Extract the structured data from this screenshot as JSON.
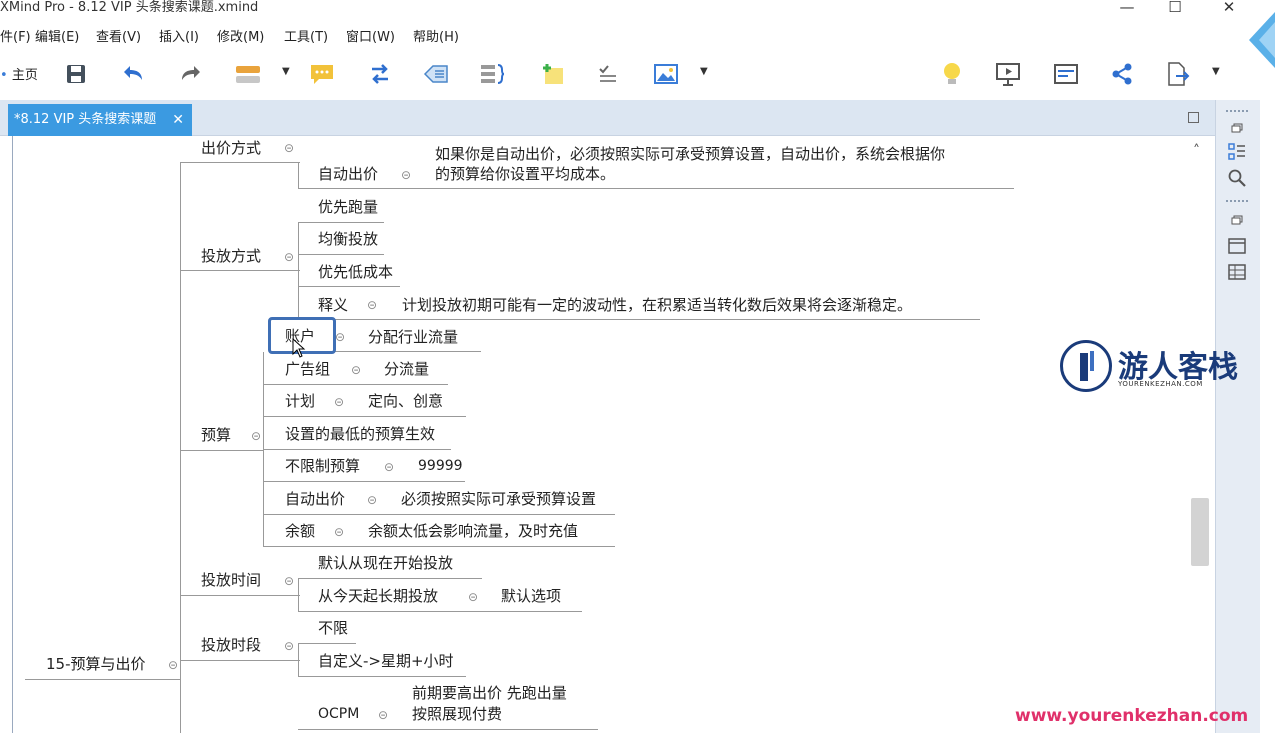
{
  "window": {
    "title": "XMind Pro - 8.12 VIP 头条搜索课题.xmind",
    "minimize": "—",
    "maximize": "☐",
    "close": "✕"
  },
  "menu": [
    "件(F)",
    "编辑(E)",
    "查看(V)",
    "插入(I)",
    "修改(M)",
    "工具(T)",
    "窗口(W)",
    "帮助(H)"
  ],
  "toolbar": {
    "home_label": "主页"
  },
  "tab": {
    "label": "*8.12 VIP 头条搜索课题",
    "close": "✕"
  },
  "canvas": {
    "scroll_up": "˄"
  },
  "mindmap": {
    "root": "15-预算与出价",
    "bid_method": {
      "label": "出价方式",
      "auto_bid": "自动出价",
      "auto_bid_note_1": "如果你是自动出价，必须按照实际可承受预算设置，自动出价，系统会根据你",
      "auto_bid_note_2": "的预算给你设置平均成本。"
    },
    "delivery_method": {
      "label": "投放方式",
      "items": [
        "优先跑量",
        "均衡投放",
        "优先低成本"
      ],
      "explain_label": "释义",
      "explain_text": "计划投放初期可能有一定的波动性，在积累适当转化数后效果将会逐渐稳定。"
    },
    "budget": {
      "label": "预算",
      "account": "账户",
      "account_note": "分配行业流量",
      "adgroup": "广告组",
      "adgroup_note": "分流量",
      "plan": "计划",
      "plan_note": "定向、创意",
      "min_budget": "设置的最低的预算生效",
      "unlimited": "不限制预算",
      "unlimited_note": "99999",
      "auto_bid": "自动出价",
      "auto_bid_note": "必须按照实际可承受预算设置",
      "balance": "余额",
      "balance_note": "余额太低会影响流量，及时充值"
    },
    "delivery_time": {
      "label": "投放时间",
      "item1": "默认从现在开始投放",
      "item2": "从今天起长期投放",
      "item2_note": "默认选项"
    },
    "delivery_period": {
      "label": "投放时段",
      "item1": "不限",
      "item2": "自定义->星期+小时"
    },
    "ocpm": {
      "label": "OCPM",
      "note_1": "前期要高出价 先跑出量",
      "note_2": "按照展现付费"
    }
  },
  "watermark": {
    "name": "游人客栈",
    "sub": "YOURENKEZHAN.COM",
    "url": "www.yourenkezhan.com"
  }
}
